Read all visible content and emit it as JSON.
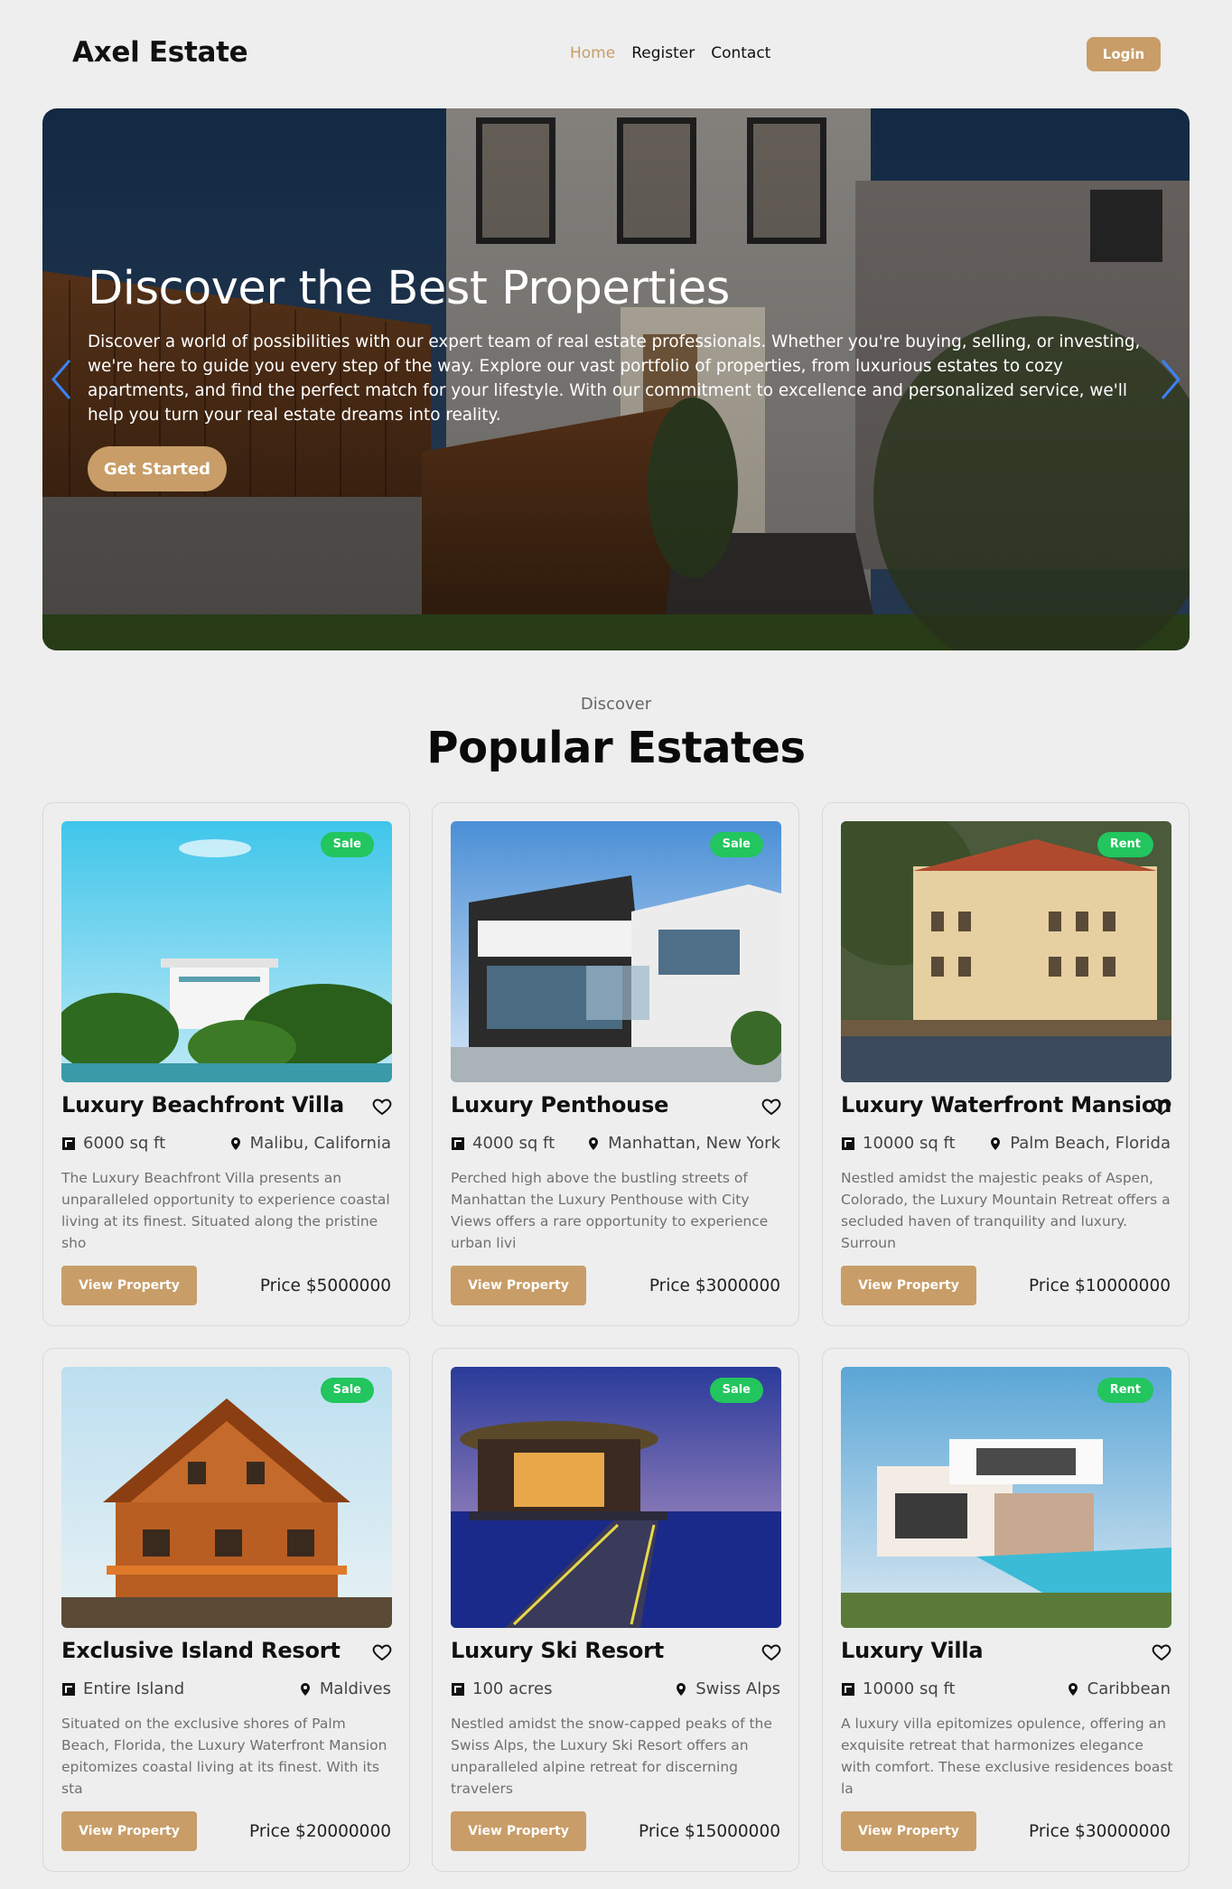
{
  "navbar": {
    "brand": "Axel Estate",
    "links": [
      "Home",
      "Register",
      "Contact"
    ],
    "login": "Login"
  },
  "hero": {
    "title": "Discover the Best Properties",
    "text": "Discover a world of possibilities with our expert team of real estate professionals. Whether you're buying, selling, or investing, we're here to guide you every step of the way. Explore our vast portfolio of properties, from luxurious estates to cozy apartments, and find the perfect match for your lifestyle. With our commitment to excellence and personalized service, we'll help you turn your real estate dreams into reality.",
    "button": "Get Started"
  },
  "section": {
    "eyebrow": "Discover",
    "title": "Popular Estates"
  },
  "colors": {
    "accent": "#c89d68",
    "badge": "#22c55e",
    "background": "#eeeeee"
  },
  "cards": [
    {
      "status": "Sale",
      "title": "Luxury Beachfront Villa",
      "area": "6000 sq ft",
      "location": "Malibu, California",
      "description": "The Luxury Beachfront Villa presents an unparalleled opportunity to experience coastal living at its finest. Situated along the pristine sho",
      "button": "View Property",
      "price": "Price $5000000"
    },
    {
      "status": "Sale",
      "title": "Luxury Penthouse",
      "area": "4000 sq ft",
      "location": "Manhattan, New York",
      "description": "Perched high above the bustling streets of Manhattan the Luxury Penthouse with City Views offers a rare opportunity to experience urban livi",
      "button": "View Property",
      "price": "Price $3000000"
    },
    {
      "status": "Rent",
      "title": "Luxury Waterfront Mansion",
      "area": "10000 sq ft",
      "location": "Palm Beach, Florida",
      "description": "Nestled amidst the majestic peaks of Aspen, Colorado, the Luxury Mountain Retreat offers a secluded haven of tranquility and luxury. Surroun",
      "button": "View Property",
      "price": "Price $10000000"
    },
    {
      "status": "Sale",
      "title": "Exclusive Island Resort",
      "area": "Entire Island",
      "location": "Maldives",
      "description": "Situated on the exclusive shores of Palm Beach, Florida, the Luxury Waterfront Mansion epitomizes coastal living at its finest. With its sta",
      "button": "View Property",
      "price": "Price $20000000"
    },
    {
      "status": "Sale",
      "title": "Luxury Ski Resort",
      "area": "100 acres",
      "location": "Swiss Alps",
      "description": "Nestled amidst the snow-capped peaks of the Swiss Alps, the Luxury Ski Resort offers an unparalleled alpine retreat for discerning travelers",
      "button": "View Property",
      "price": "Price $15000000"
    },
    {
      "status": "Rent",
      "title": "Luxury Villa",
      "area": "10000 sq ft",
      "location": "Caribbean",
      "description": "A luxury villa epitomizes opulence, offering an exquisite retreat that harmonizes elegance with comfort. These exclusive residences boast la",
      "button": "View Property",
      "price": "Price $30000000"
    }
  ]
}
